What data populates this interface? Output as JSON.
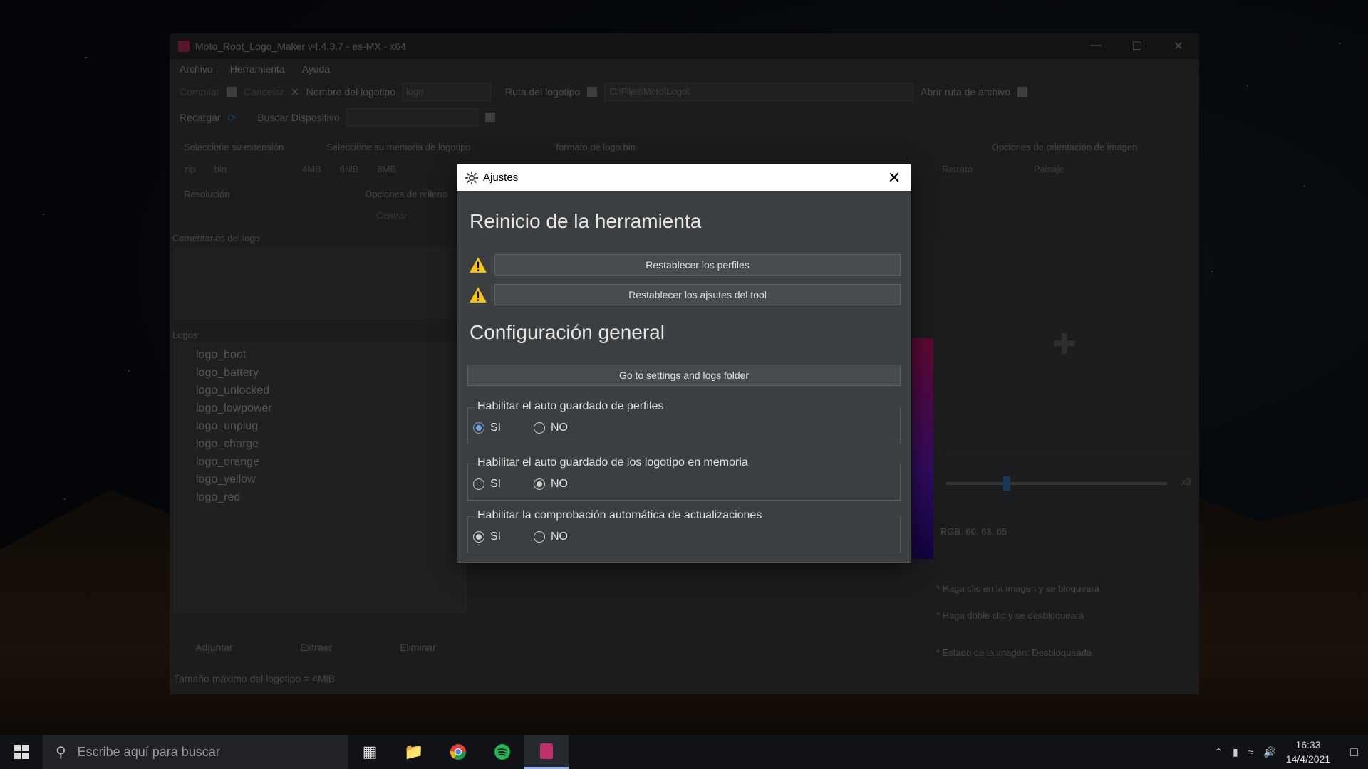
{
  "app": {
    "title": "Moto_Root_Logo_Maker v4.4.3.7 - es-MX - x64",
    "menu": [
      "Archivo",
      "Herramienta",
      "Ayuda"
    ],
    "toolbar": {
      "compile_label": "Compilar",
      "cancel_label": "Cancelar",
      "logo_name_label": "Nombre del logotipo",
      "logo_name_value": "logo",
      "logo_path_label": "Ruta del logotipo",
      "logo_path_value": "C:\\Files\\Moto\\Logo\\",
      "open_path_label": "Abrir ruta de archivo",
      "reload_label": "Recargar",
      "search_device_label": "Buscar Dispositivo"
    },
    "options": {
      "extension_label": "Seleccione su extensión",
      "extension_options": [
        "zip",
        "bin"
      ],
      "memory_label": "Seleccione su memoria de logotipo",
      "memory_options": [
        "4MB",
        "6MB",
        "8MB"
      ],
      "format_label": "formato de logo.bin",
      "orientation_label": "Opciones de orientación de imagen",
      "orientation_options": [
        "Retrato",
        "Paisaje"
      ],
      "resolution_label": "Resolución",
      "fill_label": "Opciones de relleno",
      "fill_option": "Centrar"
    },
    "comments_label": "Comentarios del logo",
    "logos_label": "Logos:",
    "logos": [
      "logo_boot",
      "logo_battery",
      "logo_unlocked",
      "logo_lowpower",
      "logo_unplug",
      "logo_charge",
      "logo_orange",
      "logo_yellow",
      "logo_red"
    ],
    "bottom_buttons": [
      "Adjuntar",
      "Extraer",
      "Eliminar"
    ],
    "status": "Tamaño máximo del logotipo = 4MiB",
    "zoom_label": "x3",
    "rgb": "RGB: 60, 63, 65",
    "hints": [
      "* Haga clic en la imagen y se bloqueará",
      "* Haga doble clic y se desbloqueará",
      "* Estado de la imagen: Desbloqueada"
    ]
  },
  "dialog": {
    "title": "Ajustes",
    "section1_title": "Reinicio de la herramienta",
    "reset_profiles_label": "Restablecer los perfiles",
    "reset_settings_label": "Restablecer los ajsutes del tool",
    "section2_title": "Configuración general",
    "open_folder_label": "Go to settings and logs folder",
    "groups": [
      {
        "title": "Habilitar el auto guardado de perfiles",
        "yes": "SI",
        "no": "NO",
        "selected": "SI"
      },
      {
        "title": "Habilitar el auto guardado de los logotipo en memoria",
        "yes": "SI",
        "no": "NO",
        "selected": "NO"
      },
      {
        "title": "Habilitar la comprobación automática de actualizaciones",
        "yes": "SI",
        "no": "NO",
        "selected": "SI"
      }
    ]
  },
  "taskbar": {
    "search_placeholder": "Escribe aquí para buscar",
    "time": "16:33",
    "date": "14/4/2021"
  },
  "colors": {
    "dialog_bg": "#3c3f41",
    "warning": "#f5c518",
    "radio_accent": "#6fa8e6"
  }
}
